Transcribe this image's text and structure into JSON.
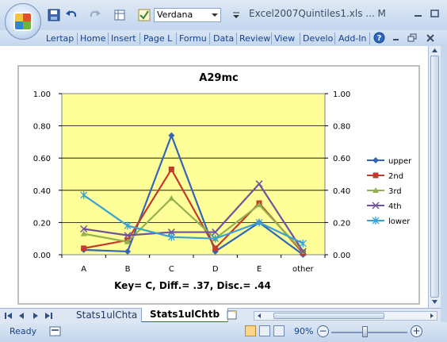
{
  "window": {
    "title": "Excel2007Quintiles1.xls ... M",
    "font_name": "Verdana"
  },
  "ribbon": {
    "tabs": [
      "Lertap",
      "Home",
      "Insert",
      "Page L",
      "Formu",
      "Data",
      "Review",
      "View",
      "Develo",
      "Add-In"
    ]
  },
  "sheets": {
    "tabs": [
      "Stats1ulChta",
      "Stats1ulChtb"
    ],
    "active": "Stats1ulChtb"
  },
  "status": {
    "ready": "Ready",
    "zoom": "90%",
    "zoom_fraction": 0.45
  },
  "colors": {
    "plot_area": "#ffff99",
    "series": [
      "#3366b4",
      "#c33a2f",
      "#94b150",
      "#70529c",
      "#3aa1d6"
    ]
  },
  "icons": [
    "save-icon",
    "undo-icon",
    "redo-icon",
    "help-icon",
    "minimize-icon",
    "restore-icon",
    "close-icon"
  ],
  "chart_data": {
    "type": "line",
    "title": "A29mc",
    "xlabel": "Key= C,  Diff.= .37,  Disc.= .44",
    "categories": [
      "A",
      "B",
      "C",
      "D",
      "E",
      "other"
    ],
    "ylim": [
      0,
      1
    ],
    "y_ticks": [
      "0.00",
      "0.20",
      "0.40",
      "0.60",
      "0.80",
      "1.00"
    ],
    "y2_ticks": [
      "0.00",
      "0.20",
      "0.40",
      "0.60",
      "0.80",
      "1.00"
    ],
    "grid": true,
    "legend_position": "right",
    "series": [
      {
        "name": "upper",
        "marker": "diamond",
        "values": [
          0.03,
          0.02,
          0.74,
          0.02,
          0.2,
          0.0
        ]
      },
      {
        "name": "2nd",
        "marker": "square",
        "values": [
          0.04,
          0.09,
          0.53,
          0.04,
          0.32,
          0.01
        ]
      },
      {
        "name": "3rd",
        "marker": "triangle",
        "values": [
          0.13,
          0.08,
          0.35,
          0.1,
          0.31,
          0.02
        ]
      },
      {
        "name": "4th",
        "marker": "x",
        "values": [
          0.16,
          0.12,
          0.14,
          0.14,
          0.44,
          0.02
        ]
      },
      {
        "name": "lower",
        "marker": "star",
        "values": [
          0.37,
          0.18,
          0.11,
          0.1,
          0.2,
          0.07
        ]
      }
    ]
  }
}
